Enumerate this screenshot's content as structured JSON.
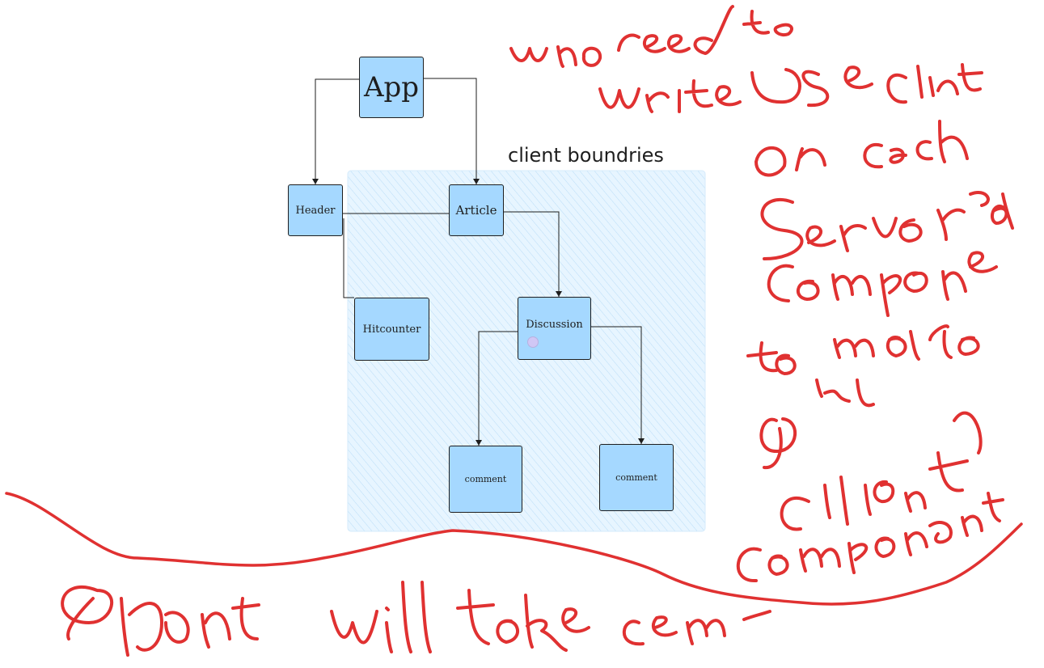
{
  "diagram": {
    "boundary_label": "client boundries",
    "nodes": {
      "app": "App",
      "header": "Header",
      "article": "Article",
      "hitcounter": "Hitcounter",
      "discussion": "Discussion",
      "comment_1": "comment",
      "comment_2": "comment"
    }
  },
  "annotations": {
    "right_note": [
      "we no need to",
      "write use client",
      "on each",
      "server",
      "component",
      "to make",
      "it's",
      "client",
      "component"
    ],
    "bottom_note": "client to will take care"
  },
  "colors": {
    "node_fill": "#a5d8ff",
    "boundary_fill": "#e7f5ff",
    "ink": "#e03131",
    "stroke": "#1e1e1e"
  }
}
